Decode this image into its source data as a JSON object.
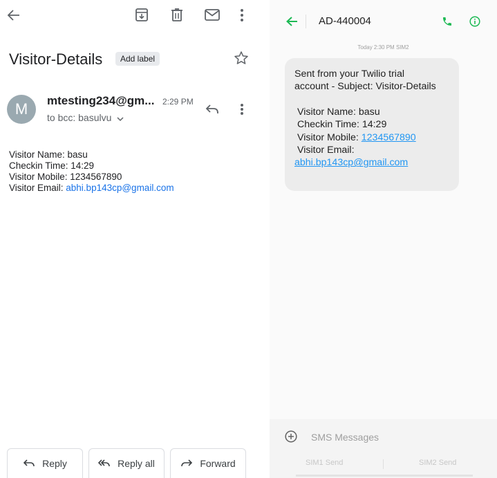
{
  "gmail": {
    "subject": "Visitor-Details",
    "label_button": "Add label",
    "avatar_letter": "M",
    "sender": "mtesting234@gm...",
    "time": "2:29 PM",
    "to_line": "to bcc: basulvu",
    "body": {
      "name_line": "Visitor Name: basu",
      "checkin_line": "Checkin Time: 14:29",
      "mobile_line": "Visitor Mobile: 1234567890",
      "email_prefix": "Visitor Email: ",
      "email_link": "abhi.bp143cp@gmail.com"
    },
    "actions": {
      "reply": "Reply",
      "reply_all": "Reply all",
      "forward": "Forward"
    },
    "icons": [
      "back-arrow-icon",
      "archive-icon",
      "delete-icon",
      "mail-icon",
      "more-vert-icon",
      "star-icon",
      "reply-icon",
      "chevron-down-icon",
      "reply-all-icon",
      "forward-icon"
    ]
  },
  "sms": {
    "contact": "AD-440004",
    "timestamp": "Today 2:30 PM  SIM2",
    "message": {
      "line1": "Sent from your Twilio trial",
      "line2": "account - Subject: Visitor-Details",
      "name": "Visitor Name: basu",
      "checkin": "Checkin Time: 14:29",
      "mobile_prefix": "Visitor Mobile: ",
      "mobile_link": "1234567890",
      "email_label": "Visitor Email:",
      "email_link": "abhi.bp143cp@gmail.com"
    },
    "compose_placeholder": "SMS Messages",
    "sim1_send": "SIM1 Send",
    "sim2_send": "SIM2 Send",
    "colors": {
      "accent_green": "#1db954",
      "link_blue": "#2196f3",
      "bubble_bg": "#ececec"
    },
    "icons": [
      "back-arrow-icon",
      "phone-icon",
      "info-icon",
      "add-circle-icon"
    ]
  }
}
